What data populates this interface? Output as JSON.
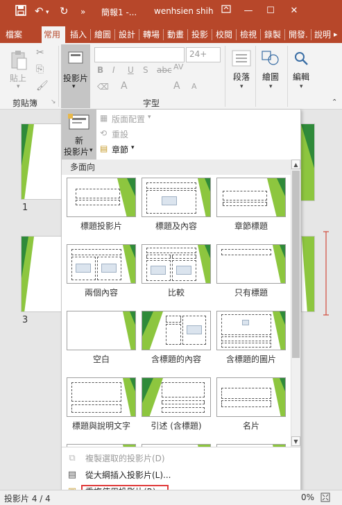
{
  "titlebar": {
    "title": "簡報1 -...",
    "user": "wenhsien shih",
    "qat_overflow": "»"
  },
  "tabs": [
    {
      "label": "檔案",
      "active": false
    },
    {
      "label": "常用",
      "active": true
    },
    {
      "label": "插入",
      "active": false
    },
    {
      "label": "繪圖",
      "active": false
    },
    {
      "label": "設計",
      "active": false
    },
    {
      "label": "轉場",
      "active": false
    },
    {
      "label": "動畫",
      "active": false
    },
    {
      "label": "投影",
      "active": false
    },
    {
      "label": "校閱",
      "active": false
    },
    {
      "label": "檢視",
      "active": false
    },
    {
      "label": "錄製",
      "active": false
    },
    {
      "label": "開發.",
      "active": false
    },
    {
      "label": "說明",
      "active": false
    }
  ],
  "ribbon": {
    "paste_label": "貼上",
    "clipboard_label": "剪貼簿",
    "slides_label": "投影片",
    "font_group_label": "字型",
    "font_size": "24+",
    "bold": "B",
    "italic": "I",
    "underline": "U",
    "strike": "S",
    "strikethrough_abc": "abc",
    "spacing": "AV",
    "text_a": "A",
    "grow_a": "A",
    "shrink_a": "A",
    "paragraph_label": "段落",
    "drawing_label": "繪圖",
    "editing_label": "編輯"
  },
  "dropdown": {
    "new_slide_label_1": "新",
    "new_slide_label_2": "投影片",
    "layout_menu": "版面配置",
    "reset": "重設",
    "section": "章節",
    "section_header": "多面向",
    "layouts": [
      {
        "name": "標題投影片"
      },
      {
        "name": "標題及內容"
      },
      {
        "name": "章節標題"
      },
      {
        "name": "兩個內容"
      },
      {
        "name": "比較"
      },
      {
        "name": "只有標題"
      },
      {
        "name": "空白"
      },
      {
        "name": "含標題的內容"
      },
      {
        "name": "含標題的圖片"
      },
      {
        "name": "標題與說明文字"
      },
      {
        "name": "引述 (含標題)"
      },
      {
        "name": "名片"
      }
    ],
    "menu_items": [
      {
        "label": "複製選取的投影片(D)",
        "enabled": false
      },
      {
        "label": "從大綱插入投影片(L)...",
        "enabled": true
      },
      {
        "label": "重複使用投影片(R)...",
        "enabled": true
      }
    ]
  },
  "thumbnails": [
    {
      "number": "1"
    },
    {
      "number": "3"
    }
  ],
  "status": {
    "slide_counter": "投影片 4 / 4",
    "zoom": "0%"
  },
  "colors": {
    "accent": "#b7472a",
    "green_light": "#8dc63f",
    "green_dark": "#2f8a3a",
    "highlight": "#e03a3a"
  }
}
